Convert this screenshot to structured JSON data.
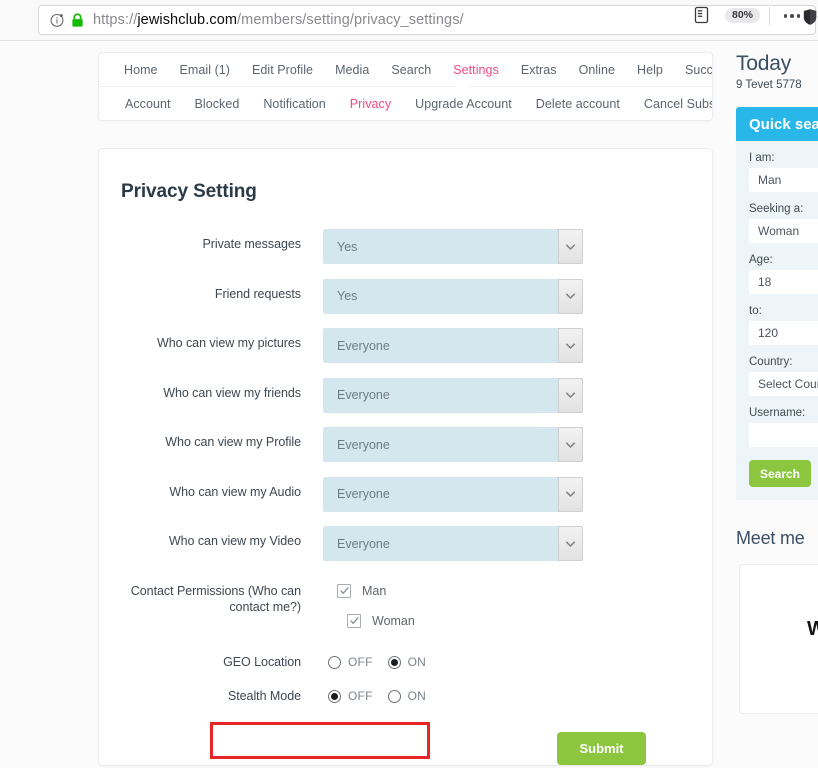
{
  "browser": {
    "url_scheme": "https://",
    "url_host": "jewishclub.com",
    "url_path": "/members/setting/privacy_settings/",
    "zoom_level": "80%",
    "info_icon": "info-circle-icon",
    "lock_icon": "padlock-secure-icon",
    "reader_icon": "reader-view-icon",
    "menu_icon": "ellipsis-menu-icon",
    "shield_icon": "tracking-protection-shield-icon"
  },
  "nav": {
    "primary": [
      {
        "label": "Home",
        "active": false
      },
      {
        "label": "Email (1)",
        "active": false
      },
      {
        "label": "Edit Profile",
        "active": false
      },
      {
        "label": "Media",
        "active": false
      },
      {
        "label": "Search",
        "active": false
      },
      {
        "label": "Settings",
        "active": true
      },
      {
        "label": "Extras",
        "active": false
      },
      {
        "label": "Online",
        "active": false
      },
      {
        "label": "Help",
        "active": false
      },
      {
        "label": "Success Story",
        "active": false
      }
    ],
    "secondary": [
      {
        "label": "Account",
        "active": false
      },
      {
        "label": "Blocked",
        "active": false
      },
      {
        "label": "Notification",
        "active": false
      },
      {
        "label": "Privacy",
        "active": true
      },
      {
        "label": "Upgrade Account",
        "active": false
      },
      {
        "label": "Delete account",
        "active": false
      },
      {
        "label": "Cancel Subscription",
        "active": false
      }
    ],
    "active_color": "#ef4a81"
  },
  "form": {
    "title": "Privacy Setting",
    "selects": [
      {
        "label": "Private messages",
        "value": "Yes"
      },
      {
        "label": "Friend requests",
        "value": "Yes"
      },
      {
        "label": "Who can view my pictures",
        "value": "Everyone"
      },
      {
        "label": "Who can view my friends",
        "value": "Everyone"
      },
      {
        "label": "Who can view my Profile",
        "value": "Everyone"
      },
      {
        "label": "Who can view my Audio",
        "value": "Everyone"
      },
      {
        "label": "Who can view my Video",
        "value": "Everyone"
      }
    ],
    "contact_permissions": {
      "label": "Contact Permissions (Who can contact me?)",
      "options": [
        {
          "label": "Man",
          "checked": true
        },
        {
          "label": "Woman",
          "checked": true
        }
      ]
    },
    "toggles": [
      {
        "label": "GEO Location",
        "off_label": "OFF",
        "on_label": "ON",
        "selected": "ON"
      },
      {
        "label": "Stealth Mode",
        "off_label": "OFF",
        "on_label": "ON",
        "selected": "OFF"
      }
    ],
    "submit_label": "Submit",
    "submit_color": "#8cc63f"
  },
  "annotation": {
    "color": "#e8262a",
    "target": "stealth-mode-row"
  },
  "sidebar": {
    "today_title": "Today",
    "today_date": "9 Tevet 5778",
    "quick_search": {
      "header": "Quick search",
      "header_color": "#29b6e8",
      "fields": [
        {
          "label": "I am:",
          "value": "Man"
        },
        {
          "label": "Seeking a:",
          "value": "Woman"
        },
        {
          "label": "Age:",
          "value": "18"
        },
        {
          "label": "to:",
          "value": "120"
        },
        {
          "label": "Country:",
          "value": "Select Country"
        },
        {
          "label": "Username:",
          "value": ""
        }
      ],
      "search_label": "Search",
      "search_color": "#8cc63f"
    },
    "meet_me_title": "Meet me",
    "meet_me_letter": "W."
  }
}
